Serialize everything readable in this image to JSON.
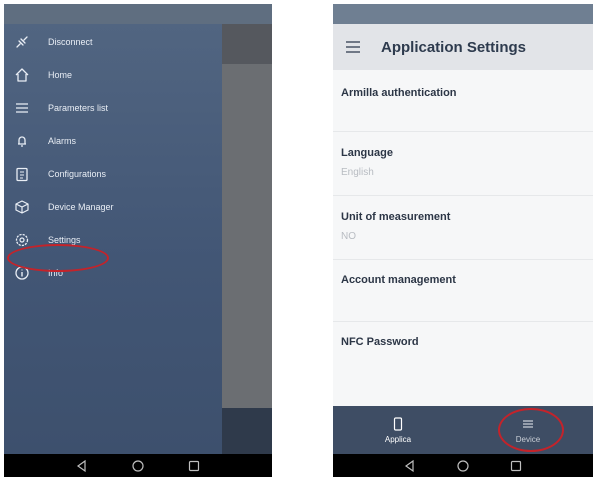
{
  "left_phone": {
    "menu": [
      {
        "label": "Disconnect",
        "icon": "disconnect-icon"
      },
      {
        "label": "Home",
        "icon": "home-icon"
      },
      {
        "label": "Parameters list",
        "icon": "list-icon"
      },
      {
        "label": "Alarms",
        "icon": "bell-icon"
      },
      {
        "label": "Configurations",
        "icon": "clipboard-icon"
      },
      {
        "label": "Device Manager",
        "icon": "box-icon"
      },
      {
        "label": "Settings",
        "icon": "gear-icon"
      },
      {
        "label": "Info",
        "icon": "info-icon"
      }
    ],
    "highlighted_item": "Settings"
  },
  "right_phone": {
    "title": "Application Settings",
    "settings": [
      {
        "label": "Armilla authentication",
        "value": ""
      },
      {
        "label": "Language",
        "value": "English"
      },
      {
        "label": "Unit of measurement",
        "value": "NO"
      },
      {
        "label": "Account management",
        "value": ""
      },
      {
        "label": "NFC Password",
        "value": ""
      }
    ],
    "bottom_nav": [
      {
        "label": "Applica",
        "icon": "phone-icon"
      },
      {
        "label": "Device",
        "icon": "menu-icon"
      }
    ],
    "highlighted_item": "Device"
  },
  "colors": {
    "drawer": "#46597a",
    "accent_highlight": "#c4232a",
    "bottom_nav": "#3e4d64"
  }
}
